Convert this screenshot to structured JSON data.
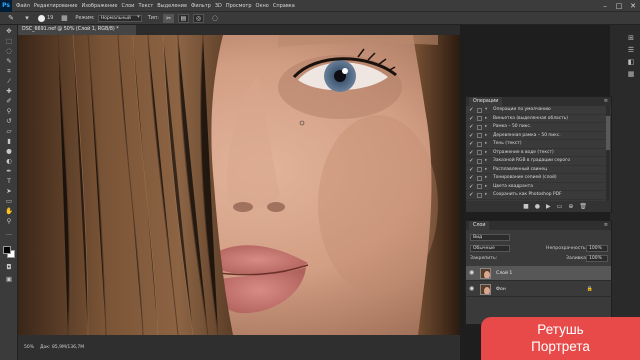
{
  "app": {
    "logo": "Ps"
  },
  "menu": [
    "Файл",
    "Редактирование",
    "Изображение",
    "Слои",
    "Текст",
    "Выделение",
    "Фильтр",
    "3D",
    "Просмотр",
    "Окно",
    "Справка"
  ],
  "window_controls": {
    "minimize": "–",
    "maximize": "□",
    "close": "✕"
  },
  "options": {
    "brush_size": "19",
    "mode_label": "Режим:",
    "mode_value": "Нормальный",
    "type_label": "Тип:"
  },
  "document": {
    "tab_title": "DSC_6691.nef @ 50% (Слой 1, RGB/8) *"
  },
  "status": {
    "zoom": "50%",
    "doc_info": "Док: 85,9M/136,7M"
  },
  "actions": {
    "tab_label": "Операции",
    "items": [
      "Операции по умолчанию",
      "Виньетка (выделенная область)",
      "Рамка – 50 пикс.",
      "Деревянная рамка – 50 пикс.",
      "Тень (текст)",
      "Отражение в воде (текст)",
      "Заказной RGB в градации серого",
      "Расплавленный свинец",
      "Тонирование сепией (слой)",
      "Цвета квадранта",
      "Сохранить как Photoshop PDF"
    ]
  },
  "layers": {
    "tab_label": "Слои",
    "filter_label": "Вид",
    "blend_mode": "Обычные",
    "opacity_label": "Непрозрачность:",
    "opacity_value": "100%",
    "lock_label": "Закрепить:",
    "fill_label": "Заливка:",
    "fill_value": "100%",
    "items": [
      {
        "name": "Слой 1",
        "selected": true
      },
      {
        "name": "Фон",
        "selected": false
      }
    ]
  },
  "banner": {
    "line1": "Ретушь",
    "line2": "Портрета"
  },
  "colors": {
    "banner": "#e84a4a",
    "ui_dark": "#3a3a3a",
    "selected_layer": "#575757"
  }
}
